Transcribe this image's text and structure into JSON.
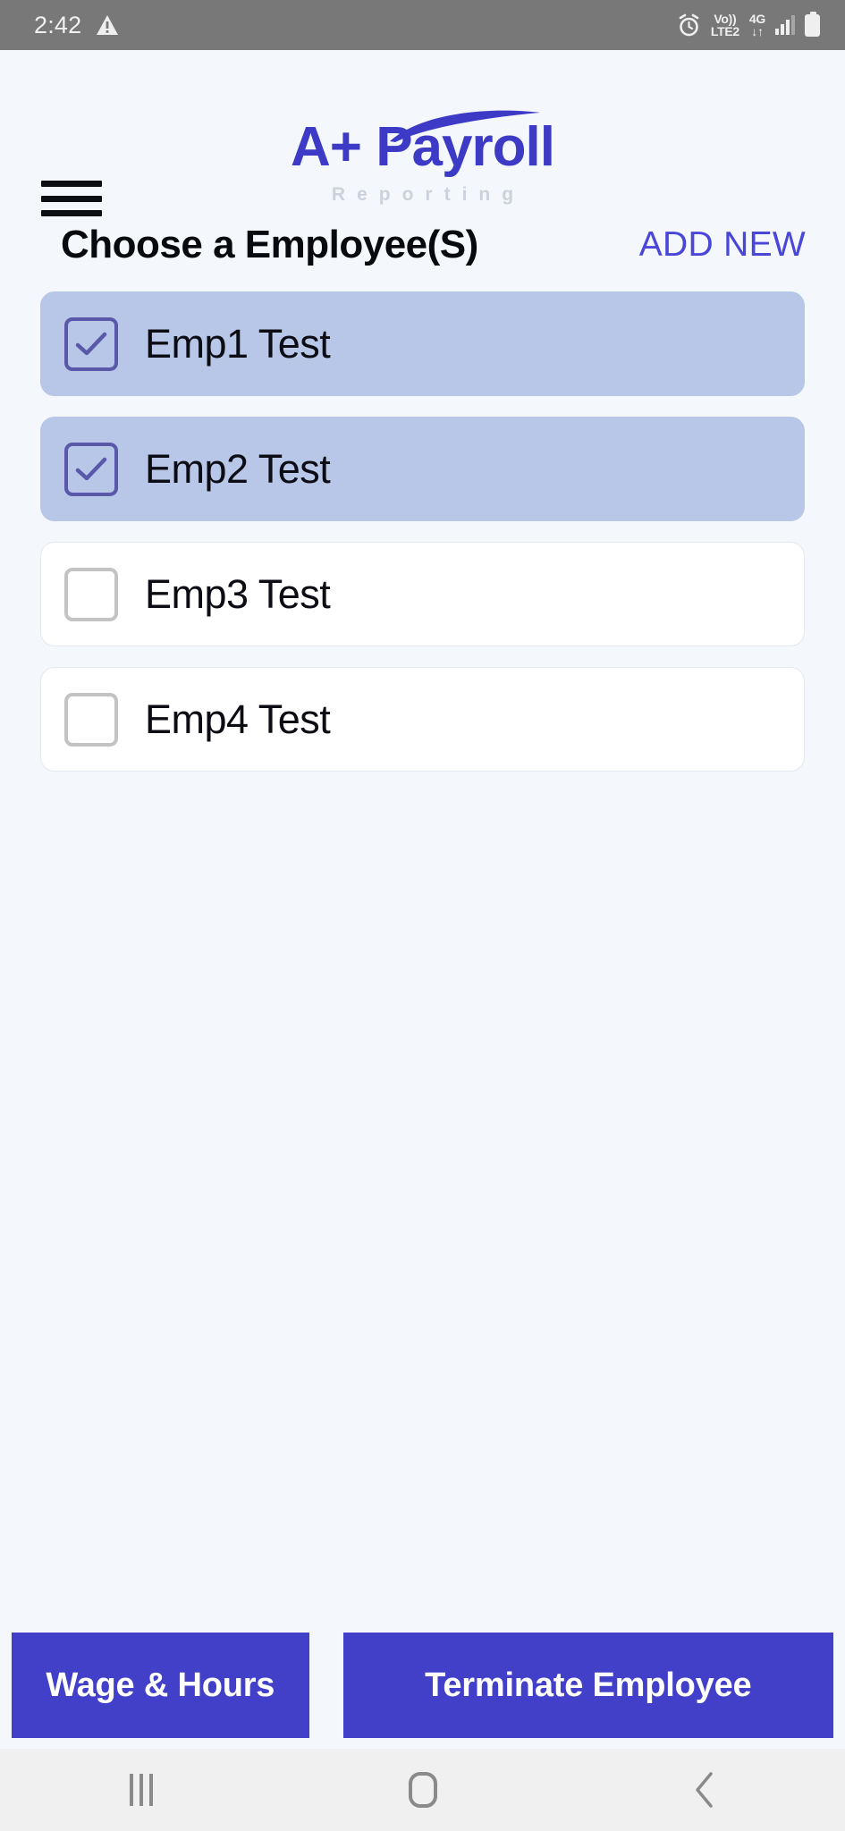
{
  "status_bar": {
    "clock": "2:42",
    "warning_icon": "warning-triangle-icon",
    "alarm_icon": "alarm-clock-icon",
    "volte_top": "Vo))",
    "volte_bottom": "LTE2",
    "network_type": "4G",
    "data_arrows": "↓↑",
    "signal_icon": "signal-bars-icon",
    "battery_icon": "battery-icon"
  },
  "header": {
    "menu_icon": "hamburger-menu-icon",
    "logo_text": "A+ Payroll",
    "logo_subtitle": "Reporting",
    "logo_color": "#3d3bc6",
    "subtitle_color": "#cbd2dd"
  },
  "title_row": {
    "title": "Choose a Employee(S)",
    "add_new_label": "ADD NEW",
    "add_new_color": "#4a46d8"
  },
  "employees": [
    {
      "name": "Emp1 Test",
      "selected": true
    },
    {
      "name": "Emp2 Test",
      "selected": true
    },
    {
      "name": "Emp3 Test",
      "selected": false
    },
    {
      "name": "Emp4 Test",
      "selected": false
    }
  ],
  "selected_row_color": "#b8c7e8",
  "unselected_row_color": "#ffffff",
  "actions": {
    "wage_hours_label": "Wage & Hours",
    "terminate_label": "Terminate Employee",
    "button_color": "#4240c8"
  },
  "nav_bar": {
    "recents_icon": "recents-icon",
    "home_icon": "home-icon",
    "back_icon": "back-chevron-icon"
  }
}
